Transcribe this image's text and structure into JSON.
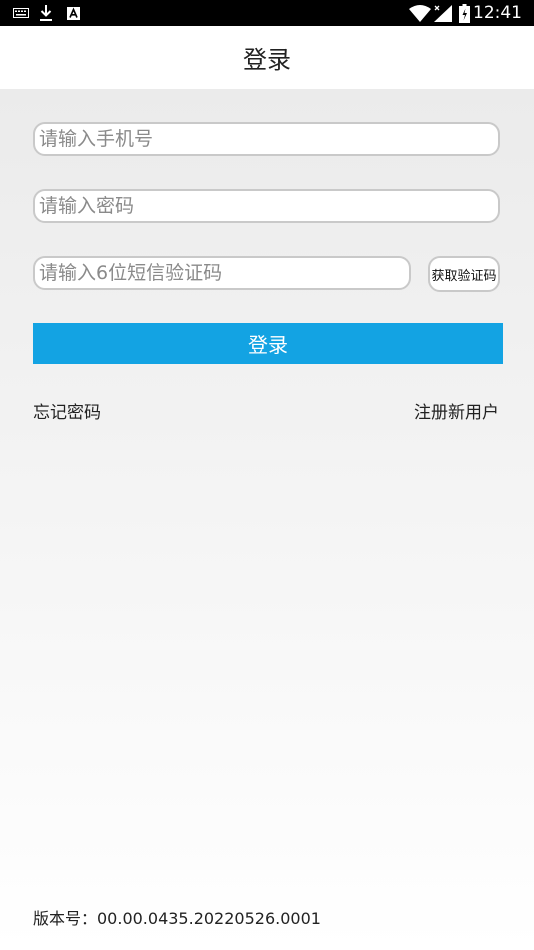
{
  "status_bar": {
    "time": "12:41",
    "icons": [
      "keyboard-icon",
      "download-icon",
      "font-a-icon",
      "wifi-icon",
      "signal-icon",
      "battery-icon"
    ]
  },
  "header": {
    "title": "登录"
  },
  "form": {
    "phone_placeholder": "请输入手机号",
    "password_placeholder": "请输入密码",
    "sms_placeholder": "请输入6位短信验证码",
    "sms_button_label": "获取验证码",
    "login_button_label": "登录"
  },
  "links": {
    "forgot_password": "忘记密码",
    "register": "注册新用户"
  },
  "footer": {
    "version": "版本号：00.00.0435.20220526.0001"
  },
  "colors": {
    "primary": "#13a3e3",
    "status_bar": "#000000",
    "header_bg": "#ffffff"
  }
}
